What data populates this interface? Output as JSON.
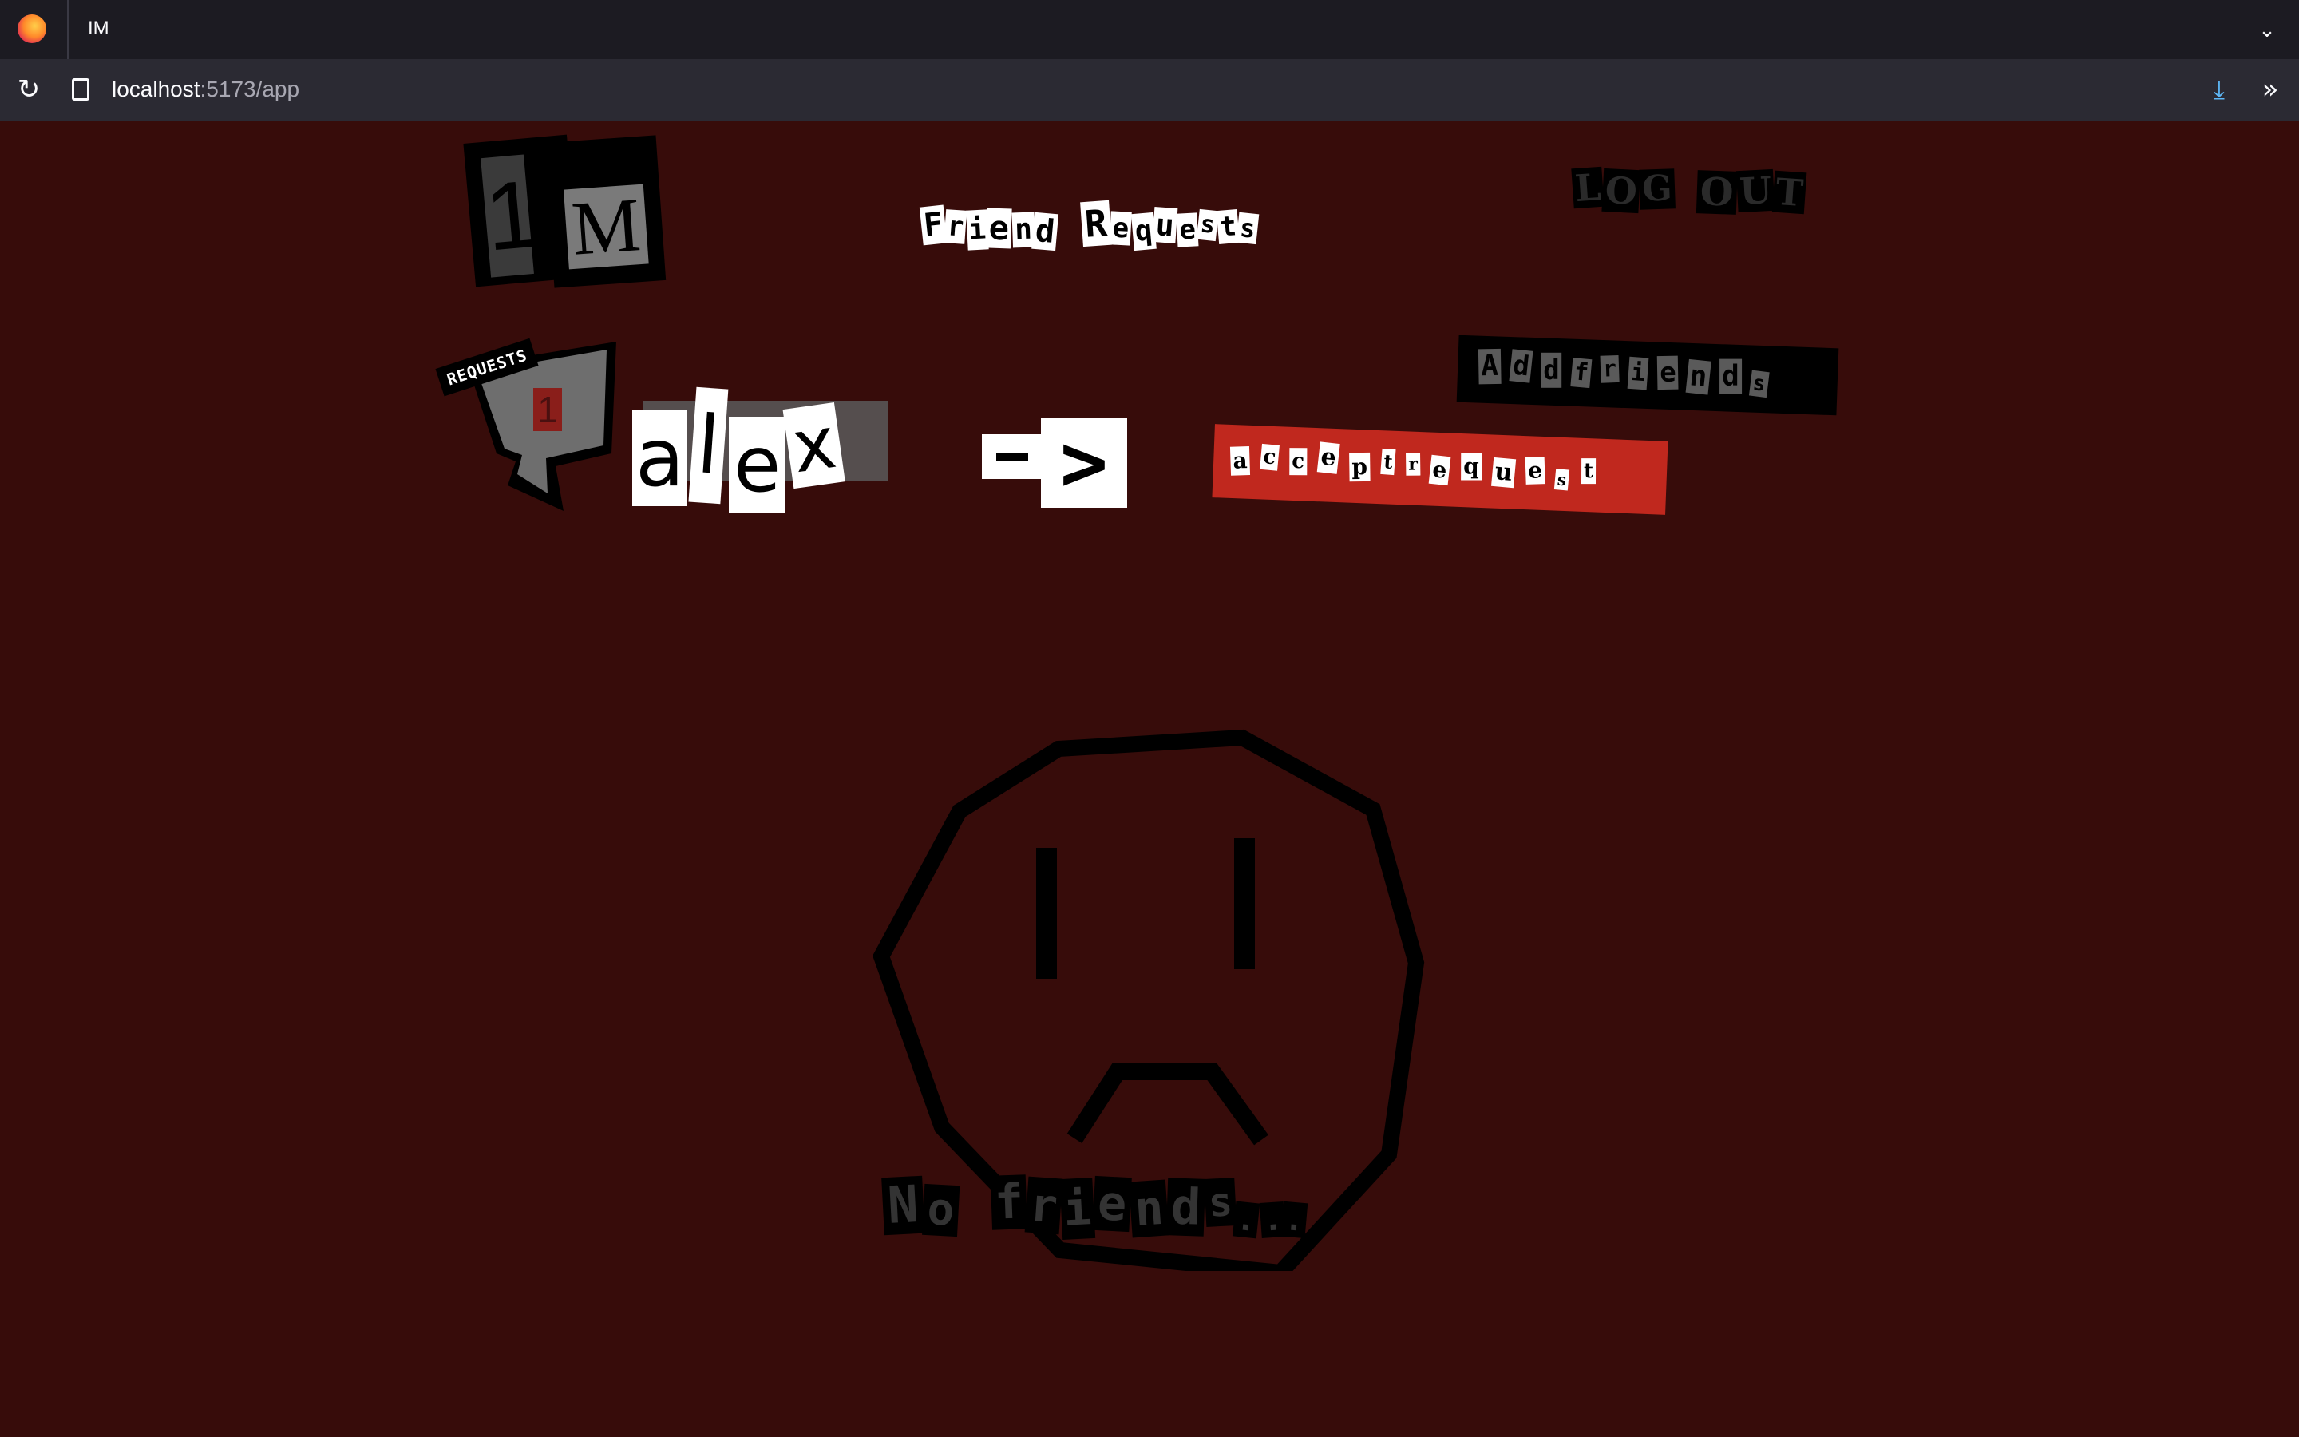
{
  "browser": {
    "tab_title": "IM",
    "url_host": "localhost",
    "url_rest": ":5173/app"
  },
  "app": {
    "logo_letters": [
      "1",
      "M"
    ],
    "title_letters": [
      "F",
      "r",
      "i",
      "e",
      "n",
      "d",
      " ",
      "R",
      "e",
      "q",
      "u",
      "e",
      "s",
      "t",
      "s"
    ],
    "logout_letters": [
      "L",
      "O",
      "G",
      " ",
      "O",
      "U",
      "T"
    ],
    "add_friends_letters": [
      "A",
      "d",
      "d",
      "f",
      "r",
      "i",
      "e",
      "n",
      "d",
      "s"
    ],
    "accept_letters": [
      "a",
      "c",
      "c",
      "e",
      "p",
      "t",
      "r",
      "e",
      "q",
      "u",
      "e",
      "s",
      "t"
    ],
    "requests_label": "REQUESTS",
    "requests_count": "1",
    "username_letters": [
      "a",
      "l",
      "e",
      "x"
    ],
    "arrow": [
      "-",
      ">"
    ],
    "no_friends_letters": [
      "N",
      "o",
      " ",
      "f",
      "r",
      "i",
      "e",
      "n",
      "d",
      "s",
      ".",
      ".",
      "."
    ],
    "colors": {
      "background": "#370c0a",
      "accent": "#c0281e",
      "tab_bar": "#1c1b22",
      "nav_bar": "#2b2a33"
    },
    "icons": [
      "firefox-icon",
      "reload-icon",
      "page-icon",
      "download-icon",
      "overflow-icon",
      "chevron-down-icon",
      "speech-bubble-icon",
      "sad-face-icon"
    ]
  }
}
